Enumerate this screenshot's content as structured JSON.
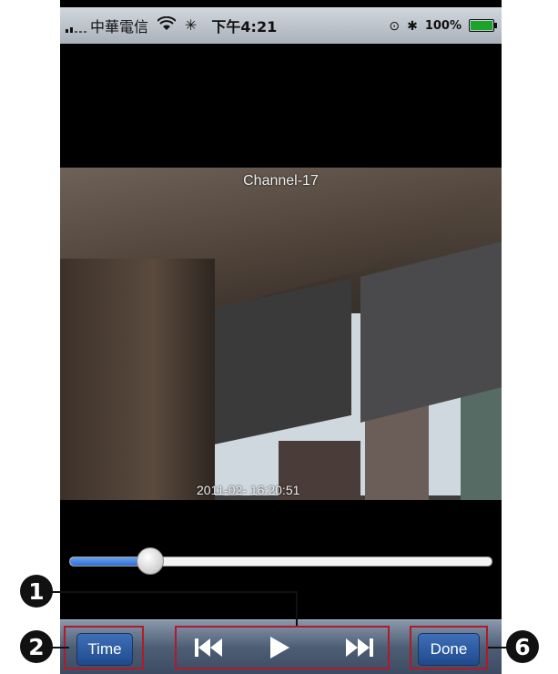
{
  "status_bar": {
    "carrier": "中華電信",
    "time": "下午4:21",
    "battery": "100%",
    "wifi_icon": "wifi-icon",
    "activity_icon": "activity-spinner-icon",
    "bluetooth_icon": "bluetooth-icon",
    "lock_icon": "orientation-lock-icon"
  },
  "video": {
    "channel": "Channel-17",
    "timestamp": "2011-02- 16:20:51"
  },
  "playback": {
    "progress": 0.19
  },
  "toolbar": {
    "time_label": "Time",
    "done_label": "Done",
    "prev_icon": "skip-previous-icon",
    "play_icon": "play-icon",
    "next_icon": "skip-next-icon"
  },
  "annotations": {
    "one": "1",
    "two": "2",
    "six": "6"
  },
  "colors": {
    "highlight": "#b01a2a",
    "slider_fill": "#2f6fd6",
    "button_blue": "#1f4a8c"
  }
}
